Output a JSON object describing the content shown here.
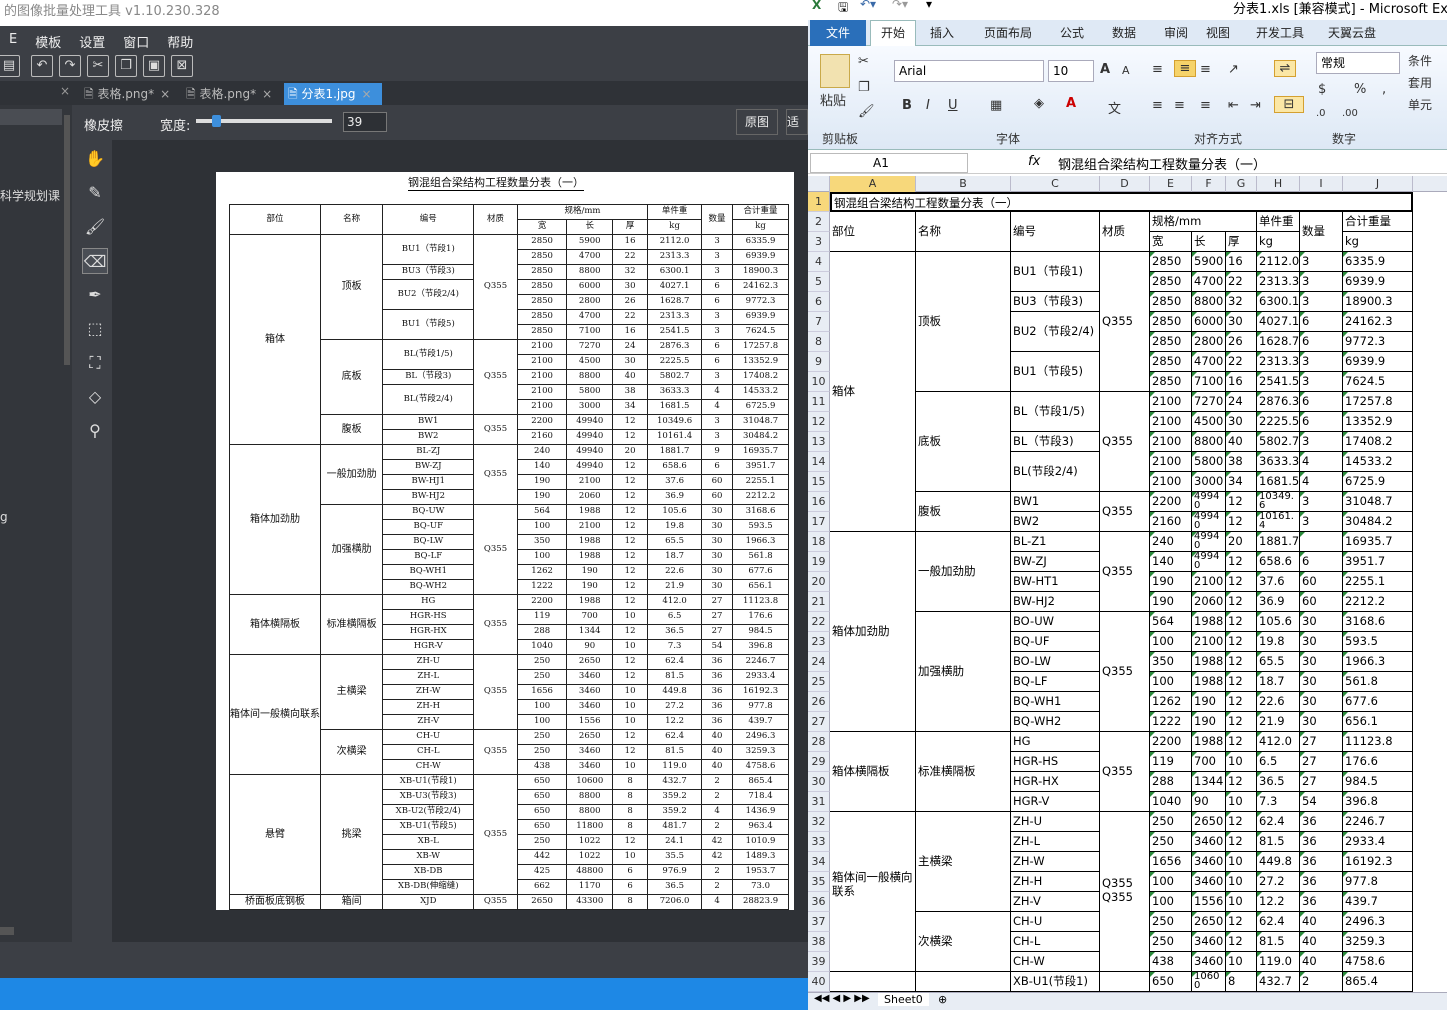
{
  "left_app": {
    "title": "的图像批量处理工具 v1.10.230.328",
    "menu": [
      "E",
      "模板",
      "设置",
      "窗口",
      "帮助"
    ],
    "tabs": [
      {
        "label": "表格.png*",
        "active": false
      },
      {
        "label": "表格.png*",
        "active": false
      },
      {
        "label": "分表1.jpg",
        "active": true
      }
    ],
    "tool_name": "橡皮擦",
    "width_label": "宽度:",
    "width_value": "39",
    "width_level": 0.12,
    "original_button": "原图",
    "cut_button": "适",
    "sidebar_text1": "科学规划课",
    "sidebar_text2": "g",
    "tools": [
      "hand-icon",
      "pen-icon",
      "brush-icon",
      "eraser-icon",
      "eyedropper-icon",
      "select-icon",
      "crop-icon",
      "lasso-icon",
      "stamp-icon"
    ]
  },
  "document": {
    "title": "钢混组合梁结构工程数量分表（一）",
    "header": [
      "部位",
      "名称",
      "编号",
      "材质",
      "规格/mm",
      "单件重",
      "数量",
      "合计重量"
    ],
    "subheader": [
      "宽",
      "长",
      "厚",
      "kg",
      "kg"
    ],
    "rows": [
      [
        "箱体",
        "顶板",
        "BU1（节段1)",
        "Q355",
        "2850",
        "5900",
        "16",
        "2112.0",
        "3",
        "6335.9"
      ],
      [
        "",
        "",
        "",
        "",
        "2850",
        "4700",
        "22",
        "2313.3",
        "3",
        "6939.9"
      ],
      [
        "",
        "",
        "BU3（节段3)",
        "",
        "2850",
        "8800",
        "32",
        "6300.1",
        "3",
        "18900.3"
      ],
      [
        "",
        "",
        "BU2（节段2/4)",
        "",
        "2850",
        "6000",
        "30",
        "4027.1",
        "6",
        "24162.3"
      ],
      [
        "",
        "",
        "",
        "",
        "2850",
        "2800",
        "26",
        "1628.7",
        "6",
        "9772.3"
      ],
      [
        "",
        "",
        "BU1（节段5)",
        "",
        "2850",
        "4700",
        "22",
        "2313.3",
        "3",
        "6939.9"
      ],
      [
        "",
        "",
        "",
        "",
        "2850",
        "7100",
        "16",
        "2541.5",
        "3",
        "7624.5"
      ],
      [
        "",
        "底板",
        "BL(节段1/5)",
        "Q355",
        "2100",
        "7270",
        "24",
        "2876.3",
        "6",
        "17257.8"
      ],
      [
        "",
        "",
        "",
        "",
        "2100",
        "4500",
        "30",
        "2225.5",
        "6",
        "13352.9"
      ],
      [
        "",
        "",
        "BL（节段3)",
        "",
        "2100",
        "8800",
        "40",
        "5802.7",
        "3",
        "17408.2"
      ],
      [
        "",
        "",
        "BL(节段2/4)",
        "",
        "2100",
        "5800",
        "38",
        "3633.3",
        "4",
        "14533.2"
      ],
      [
        "",
        "",
        "",
        "",
        "2100",
        "3000",
        "34",
        "1681.5",
        "4",
        "6725.9"
      ],
      [
        "",
        "腹板",
        "BW1",
        "Q355",
        "2200",
        "49940",
        "12",
        "10349.6",
        "3",
        "31048.7"
      ],
      [
        "",
        "",
        "BW2",
        "",
        "2160",
        "49940",
        "12",
        "10161.4",
        "3",
        "30484.2"
      ],
      [
        "箱体加劲肋",
        "一般加劲肋",
        "BL-ZJ",
        "Q355",
        "240",
        "49940",
        "20",
        "1881.7",
        "9",
        "16935.7"
      ],
      [
        "",
        "",
        "BW-ZJ",
        "",
        "140",
        "49940",
        "12",
        "658.6",
        "6",
        "3951.7"
      ],
      [
        "",
        "",
        "BW-HJ1",
        "",
        "190",
        "2100",
        "12",
        "37.6",
        "60",
        "2255.1"
      ],
      [
        "",
        "",
        "BW-HJ2",
        "",
        "190",
        "2060",
        "12",
        "36.9",
        "60",
        "2212.2"
      ],
      [
        "",
        "加强横肋",
        "BQ-UW",
        "Q355",
        "564",
        "1988",
        "12",
        "105.6",
        "30",
        "3168.6"
      ],
      [
        "",
        "",
        "BQ-UF",
        "",
        "100",
        "2100",
        "12",
        "19.8",
        "30",
        "593.5"
      ],
      [
        "",
        "",
        "BQ-LW",
        "",
        "350",
        "1988",
        "12",
        "65.5",
        "30",
        "1966.3"
      ],
      [
        "",
        "",
        "BQ-LF",
        "",
        "100",
        "1988",
        "12",
        "18.7",
        "30",
        "561.8"
      ],
      [
        "",
        "",
        "BQ-WH1",
        "",
        "1262",
        "190",
        "12",
        "22.6",
        "30",
        "677.6"
      ],
      [
        "",
        "",
        "BQ-WH2",
        "",
        "1222",
        "190",
        "12",
        "21.9",
        "30",
        "656.1"
      ],
      [
        "箱体横隔板",
        "标准横隔板",
        "HG",
        "Q355",
        "2200",
        "1988",
        "12",
        "412.0",
        "27",
        "11123.8"
      ],
      [
        "",
        "",
        "HGR-HS",
        "",
        "119",
        "700",
        "10",
        "6.5",
        "27",
        "176.6"
      ],
      [
        "",
        "",
        "HGR-HX",
        "",
        "288",
        "1344",
        "12",
        "36.5",
        "27",
        "984.5"
      ],
      [
        "",
        "",
        "HGR-V",
        "",
        "1040",
        "90",
        "10",
        "7.3",
        "54",
        "396.8"
      ],
      [
        "箱体间一般横向联系",
        "主横梁",
        "ZH-U",
        "Q355",
        "250",
        "2650",
        "12",
        "62.4",
        "36",
        "2246.7"
      ],
      [
        "",
        "",
        "ZH-L",
        "",
        "250",
        "3460",
        "12",
        "81.5",
        "36",
        "2933.4"
      ],
      [
        "",
        "",
        "ZH-W",
        "",
        "1656",
        "3460",
        "10",
        "449.8",
        "36",
        "16192.3"
      ],
      [
        "",
        "",
        "ZH-H",
        "",
        "100",
        "3460",
        "10",
        "27.2",
        "36",
        "977.8"
      ],
      [
        "",
        "",
        "ZH-V",
        "",
        "100",
        "1556",
        "10",
        "12.2",
        "36",
        "439.7"
      ],
      [
        "",
        "次横梁",
        "CH-U",
        "Q355",
        "250",
        "2650",
        "12",
        "62.4",
        "40",
        "2496.3"
      ],
      [
        "",
        "",
        "CH-L",
        "",
        "250",
        "3460",
        "12",
        "81.5",
        "40",
        "3259.3"
      ],
      [
        "",
        "",
        "CH-W",
        "",
        "438",
        "3460",
        "10",
        "119.0",
        "40",
        "4758.6"
      ],
      [
        "悬臂",
        "挑梁",
        "XB-U1(节段1)",
        "Q355",
        "650",
        "10600",
        "8",
        "432.7",
        "2",
        "865.4"
      ],
      [
        "",
        "",
        "XB-U3(节段3)",
        "",
        "650",
        "8800",
        "8",
        "359.2",
        "2",
        "718.4"
      ],
      [
        "",
        "",
        "XB-U2(节段2/4)",
        "",
        "650",
        "8800",
        "8",
        "359.2",
        "4",
        "1436.9"
      ],
      [
        "",
        "",
        "XB-U1(节段5)",
        "",
        "650",
        "11800",
        "8",
        "481.7",
        "2",
        "963.4"
      ],
      [
        "",
        "",
        "XB-L",
        "",
        "250",
        "1022",
        "12",
        "24.1",
        "42",
        "1010.9"
      ],
      [
        "",
        "",
        "XB-W",
        "",
        "442",
        "1022",
        "10",
        "35.5",
        "42",
        "1489.3"
      ],
      [
        "",
        "",
        "XB-DB",
        "",
        "425",
        "48800",
        "6",
        "976.9",
        "2",
        "1953.7"
      ],
      [
        "",
        "",
        "XB-DB(伸缩缝)",
        "",
        "662",
        "1170",
        "6",
        "36.5",
        "2",
        "73.0"
      ],
      [
        "桥面板底钢板",
        "箱间",
        "XJD",
        "Q355",
        "2650",
        "43300",
        "8",
        "7206.0",
        "4",
        "28823.9"
      ]
    ]
  },
  "excel": {
    "window_title": "分表1.xls [兼容模式] - Microsoft Exce",
    "ribbon_tabs": [
      "文件",
      "开始",
      "插入",
      "页面布局",
      "公式",
      "数据",
      "审阅",
      "视图",
      "开发工具",
      "天翼云盘"
    ],
    "font_name": "Arial",
    "font_size": "10",
    "number_format": "常规",
    "groups": [
      "剪贴板",
      "字体",
      "对齐方式",
      "数字"
    ],
    "paste_label": "粘贴",
    "right_labels": [
      "条件",
      "套用",
      "单元"
    ],
    "name_box": "A1",
    "fx": "fx",
    "formula": "钢混组合梁结构工程数量分表（一）",
    "columns": [
      "A",
      "B",
      "C",
      "D",
      "E",
      "F",
      "G",
      "H",
      "I",
      "J"
    ],
    "sheet_tab": "Sheet0",
    "row_numbers": [
      "1",
      "2",
      "3",
      "4",
      "5",
      "6",
      "7",
      "8",
      "9",
      "10",
      "11",
      "12",
      "13",
      "14",
      "15",
      "16",
      "17",
      "18",
      "19",
      "20",
      "21",
      "22",
      "23",
      "24",
      "25",
      "26",
      "27",
      "28",
      "29",
      "30",
      "31",
      "32",
      "33",
      "34",
      "35",
      "36",
      "37",
      "38",
      "39",
      "40"
    ],
    "cells": [
      [
        "钢混组合梁结构工程数量分表（一）"
      ],
      [
        "部位",
        "名称",
        "编号",
        "材质",
        "规格/mm",
        "",
        "",
        "单件重",
        "数量",
        "合计重量"
      ],
      [
        "",
        "",
        "",
        "",
        "宽",
        "长",
        "厚",
        "kg",
        "",
        "kg"
      ],
      [
        "",
        "",
        "BU1（节段1)",
        "",
        "2850",
        "5900",
        "16",
        "2112.0",
        "3",
        "6335.9"
      ],
      [
        "",
        "",
        "",
        "",
        "2850",
        "4700",
        "22",
        "2313.3",
        "3",
        "6939.9"
      ],
      [
        "",
        "",
        "BU3（节段3)",
        "",
        "2850",
        "8800",
        "32",
        "6300.1",
        "3",
        "18900.3"
      ],
      [
        "",
        "",
        "BU2（节段2/4)",
        "",
        "2850",
        "6000",
        "30",
        "4027.1",
        "6",
        "24162.3"
      ],
      [
        "",
        "",
        "",
        "",
        "2850",
        "2800",
        "26",
        "1628.7",
        "6",
        "9772.3"
      ],
      [
        "",
        "",
        "BU1（节段5)",
        "",
        "2850",
        "4700",
        "22",
        "2313.3",
        "3",
        "6939.9"
      ],
      [
        "",
        "",
        "",
        "",
        "2850",
        "7100",
        "16",
        "2541.5",
        "3",
        "7624.5"
      ],
      [
        "",
        "",
        "BL（节段1/5)",
        "",
        "2100",
        "7270",
        "24",
        "2876.3",
        "6",
        "17257.8"
      ],
      [
        "",
        "",
        "",
        "",
        "2100",
        "4500",
        "30",
        "2225.5",
        "6",
        "13352.9"
      ],
      [
        "",
        "",
        "BL（节段3)",
        "",
        "2100",
        "8800",
        "40",
        "5802.7",
        "3",
        "17408.2"
      ],
      [
        "",
        "",
        "BL(节段2/4)",
        "",
        "2100",
        "5800",
        "38",
        "3633.3",
        "4",
        "14533.2"
      ],
      [
        "",
        "",
        "",
        "",
        "2100",
        "3000",
        "34",
        "1681.5",
        "4",
        "6725.9"
      ],
      [
        "",
        "",
        "BW1",
        "",
        "2200",
        "4994\n0",
        "12",
        "10349.\n6",
        "3",
        "31048.7"
      ],
      [
        "",
        "",
        "BW2",
        "",
        "2160",
        "4994\n0",
        "12",
        "10161.\n4",
        "3",
        "30484.2"
      ],
      [
        "",
        "",
        "BL-Z1",
        "",
        "240",
        "4994\n0",
        "20",
        "1881.7",
        "",
        "16935.7"
      ],
      [
        "",
        "",
        "BW-ZJ",
        "",
        "140",
        "4994\n0",
        "12",
        "658.6",
        "6",
        "3951.7"
      ],
      [
        "",
        "",
        "BW-HT1",
        "",
        "190",
        "2100",
        "12",
        "37.6",
        "60",
        "2255.1"
      ],
      [
        "",
        "",
        "BW-HJ2",
        "",
        "190",
        "2060",
        "12",
        "36.9",
        "60",
        "2212.2"
      ],
      [
        "",
        "",
        "BO-UW",
        "",
        "564",
        "1988",
        "12",
        "105.6",
        "30",
        "3168.6"
      ],
      [
        "",
        "",
        "BQ-UF",
        "",
        "100",
        "2100",
        "12",
        "19.8",
        "30",
        "593.5"
      ],
      [
        "",
        "",
        "BO-LW",
        "",
        "350",
        "1988",
        "12",
        "65.5",
        "30",
        "1966.3"
      ],
      [
        "",
        "",
        "BQ-LF",
        "",
        "100",
        "1988",
        "12",
        "18.7",
        "30",
        "561.8"
      ],
      [
        "",
        "",
        "BQ-WH1",
        "",
        "1262",
        "190",
        "12",
        "22.6",
        "30",
        "677.6"
      ],
      [
        "",
        "",
        "BQ-WH2",
        "",
        "1222",
        "190",
        "12",
        "21.9",
        "30",
        "656.1"
      ],
      [
        "",
        "",
        "HG",
        "",
        "2200",
        "1988",
        "12",
        "412.0",
        "27",
        "11123.8"
      ],
      [
        "",
        "",
        "HGR-HS",
        "",
        "119",
        "700",
        "10",
        "6.5",
        "27",
        "176.6"
      ],
      [
        "",
        "",
        "HGR-HX",
        "",
        "288",
        "1344",
        "12",
        "36.5",
        "27",
        "984.5"
      ],
      [
        "",
        "",
        "HGR-V",
        "",
        "1040",
        "90",
        "10",
        "7.3",
        "54",
        "396.8"
      ],
      [
        "",
        "",
        "ZH-U",
        "",
        "250",
        "2650",
        "12",
        "62.4",
        "36",
        "2246.7"
      ],
      [
        "",
        "",
        "ZH-L",
        "",
        "250",
        "3460",
        "12",
        "81.5",
        "36",
        "2933.4"
      ],
      [
        "",
        "",
        "ZH-W",
        "",
        "1656",
        "3460",
        "10",
        "449.8",
        "36",
        "16192.3"
      ],
      [
        "",
        "",
        "ZH-H",
        "",
        "100",
        "3460",
        "10",
        "27.2",
        "36",
        "977.8"
      ],
      [
        "",
        "",
        "ZH-V",
        "",
        "100",
        "1556",
        "10",
        "12.2",
        "36",
        "439.7"
      ],
      [
        "",
        "",
        "CH-U",
        "",
        "250",
        "2650",
        "12",
        "62.4",
        "40",
        "2496.3"
      ],
      [
        "",
        "",
        "CH-L",
        "",
        "250",
        "3460",
        "12",
        "81.5",
        "40",
        "3259.3"
      ],
      [
        "",
        "",
        "CH-W",
        "",
        "438",
        "3460",
        "10",
        "119.0",
        "40",
        "4758.6"
      ],
      [
        "",
        "",
        "XB-U1(节段1)",
        "",
        "650",
        "1060\n0",
        "8",
        "432.7",
        "2",
        "865.4"
      ]
    ],
    "merged_labels": {
      "a_xiangti": "箱体",
      "b_dingban": "顶板",
      "b_diban": "底板",
      "b_fuban": "腹板",
      "a_jiajin": "箱体加劲肋",
      "b_yiban": "一般加劲肋",
      "b_jiaqiang": "加强横肋",
      "a_hengge": "箱体横隔板",
      "b_biaozhun": "标准横隔板",
      "a_lianxi": "箱体间一般横向\n联系",
      "b_zhu": "主横梁",
      "b_ci": "次横梁",
      "q355": "Q355",
      "q355b": "Q355\nQ355"
    }
  }
}
